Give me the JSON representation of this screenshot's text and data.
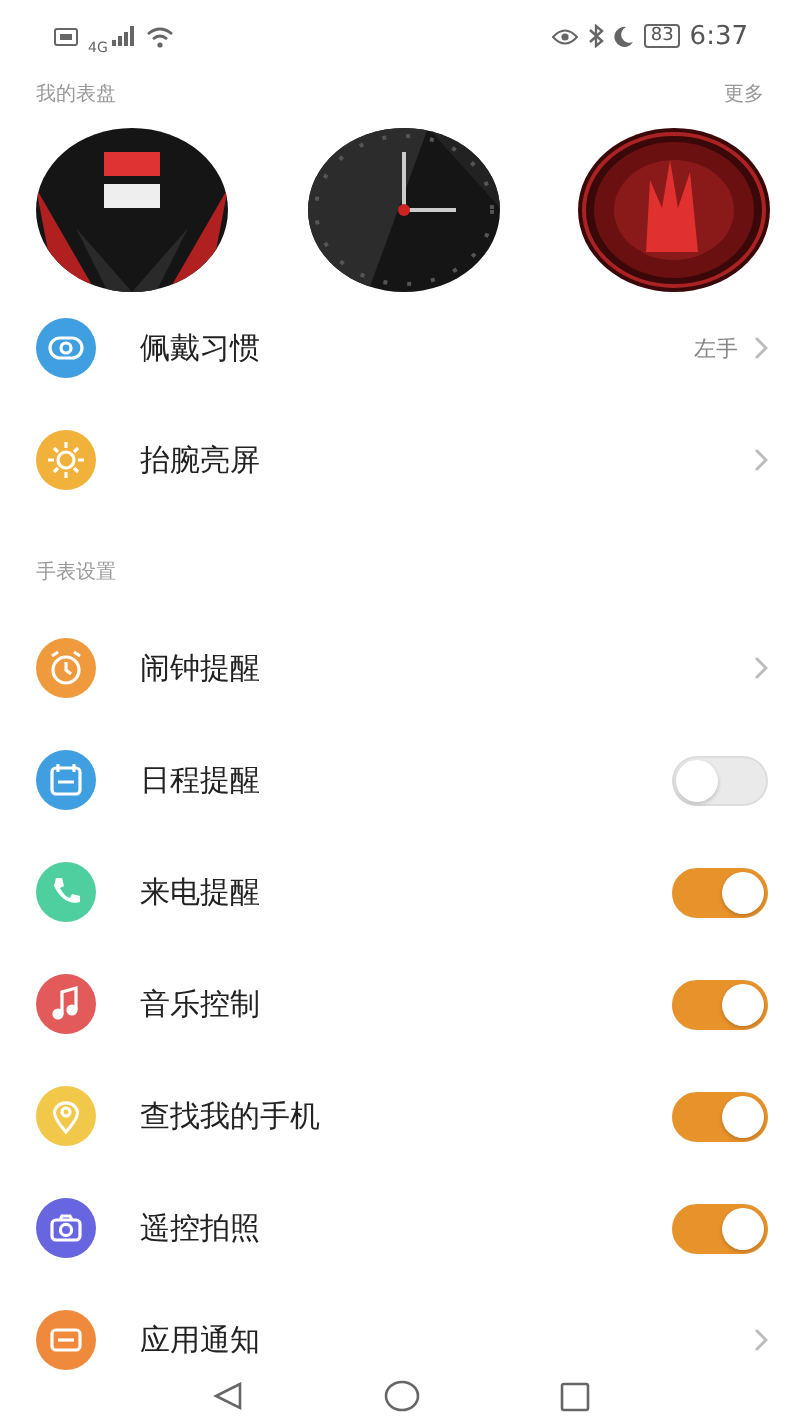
{
  "status_bar": {
    "network": "4G",
    "battery": "83",
    "time": "6:37"
  },
  "faces_section": {
    "title": "我的表盘",
    "more": "更多"
  },
  "top_items": [
    {
      "label": "佩戴习惯",
      "value": "左手",
      "kind": "link"
    },
    {
      "label": "抬腕亮屏",
      "kind": "link"
    }
  ],
  "settings_section": {
    "title": "手表设置",
    "items": [
      {
        "label": "闹钟提醒",
        "kind": "link"
      },
      {
        "label": "日程提醒",
        "kind": "toggle",
        "on": false
      },
      {
        "label": "来电提醒",
        "kind": "toggle",
        "on": true
      },
      {
        "label": "音乐控制",
        "kind": "toggle",
        "on": true
      },
      {
        "label": "查找我的手机",
        "kind": "toggle",
        "on": true
      },
      {
        "label": "遥控拍照",
        "kind": "toggle",
        "on": true
      },
      {
        "label": "应用通知",
        "kind": "link"
      }
    ]
  }
}
